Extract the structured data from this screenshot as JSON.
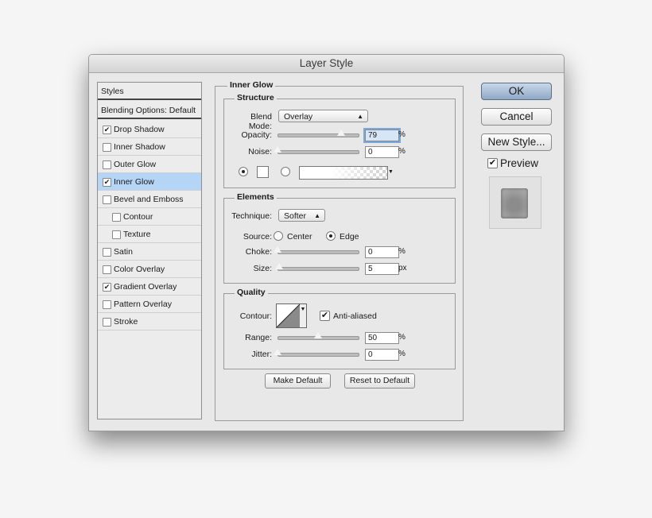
{
  "window": {
    "title": "Layer Style"
  },
  "styles_panel": {
    "header": "Styles",
    "blending_options": "Blending Options: Default",
    "items": [
      {
        "label": "Drop Shadow",
        "checked": true
      },
      {
        "label": "Inner Shadow",
        "checked": false
      },
      {
        "label": "Outer Glow",
        "checked": false
      },
      {
        "label": "Inner Glow",
        "checked": true,
        "selected": true
      },
      {
        "label": "Bevel and Emboss",
        "checked": false
      },
      {
        "label": "Contour",
        "checked": false,
        "indent": true
      },
      {
        "label": "Texture",
        "checked": false,
        "indent": true
      },
      {
        "label": "Satin",
        "checked": false
      },
      {
        "label": "Color Overlay",
        "checked": false
      },
      {
        "label": "Gradient Overlay",
        "checked": true
      },
      {
        "label": "Pattern Overlay",
        "checked": false
      },
      {
        "label": "Stroke",
        "checked": false
      }
    ]
  },
  "inner_glow": {
    "title": "Inner Glow",
    "structure": {
      "title": "Structure",
      "blend_mode_label": "Blend Mode:",
      "blend_mode_value": "Overlay",
      "opacity_label": "Opacity:",
      "opacity_value": "79",
      "opacity_unit": "%",
      "opacity_level": 79,
      "noise_label": "Noise:",
      "noise_value": "0",
      "noise_unit": "%",
      "noise_level": 0
    },
    "elements": {
      "title": "Elements",
      "technique_label": "Technique:",
      "technique_value": "Softer",
      "source_label": "Source:",
      "source_center": "Center",
      "source_edge": "Edge",
      "choke_label": "Choke:",
      "choke_value": "0",
      "choke_unit": "%",
      "choke_level": 0,
      "size_label": "Size:",
      "size_value": "5",
      "size_unit": "px",
      "size_level": 2
    },
    "quality": {
      "title": "Quality",
      "contour_label": "Contour:",
      "anti_aliased_label": "Anti-aliased",
      "anti_aliased": true,
      "range_label": "Range:",
      "range_value": "50",
      "range_unit": "%",
      "range_level": 50,
      "jitter_label": "Jitter:",
      "jitter_value": "0",
      "jitter_unit": "%",
      "jitter_level": 0
    },
    "make_default": "Make Default",
    "reset_default": "Reset to Default"
  },
  "actions": {
    "ok": "OK",
    "cancel": "Cancel",
    "new_style": "New Style...",
    "preview_label": "Preview",
    "preview_checked": true
  }
}
